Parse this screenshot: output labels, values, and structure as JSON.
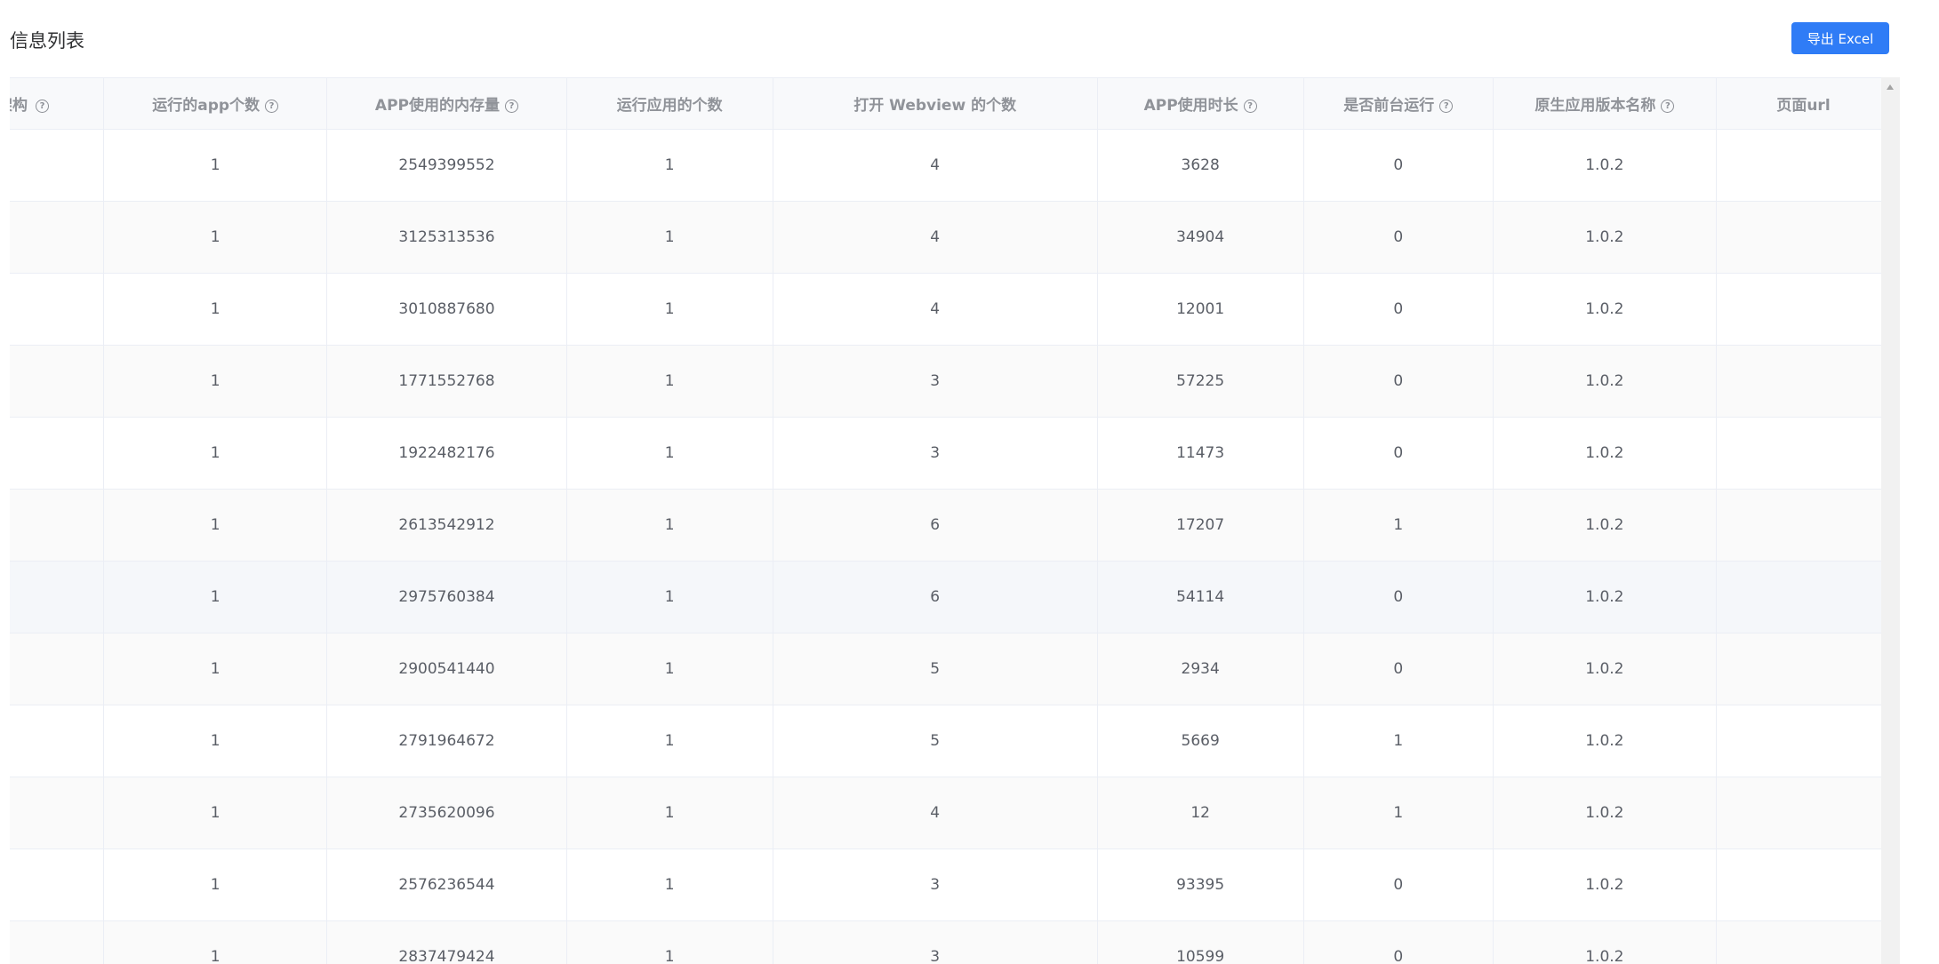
{
  "page": {
    "title": "信息列表"
  },
  "toolbar": {
    "export_label": "导出 Excel"
  },
  "table": {
    "columns": [
      {
        "label": "架构",
        "help": true
      },
      {
        "label": "运行的app个数",
        "help": true
      },
      {
        "label": "APP使用的内存量",
        "help": true
      },
      {
        "label": "运行应用的个数",
        "help": false
      },
      {
        "label": "打开 Webview 的个数",
        "help": false
      },
      {
        "label": "APP使用时长",
        "help": true
      },
      {
        "label": "是否前台运行",
        "help": true
      },
      {
        "label": "原生应用版本名称",
        "help": true
      },
      {
        "label": "页面url",
        "help": false
      }
    ],
    "rows": [
      [
        "",
        "1",
        "2549399552",
        "1",
        "4",
        "3628",
        "0",
        "1.0.2",
        ""
      ],
      [
        "",
        "1",
        "3125313536",
        "1",
        "4",
        "34904",
        "0",
        "1.0.2",
        ""
      ],
      [
        "",
        "1",
        "3010887680",
        "1",
        "4",
        "12001",
        "0",
        "1.0.2",
        ""
      ],
      [
        "",
        "1",
        "1771552768",
        "1",
        "3",
        "57225",
        "0",
        "1.0.2",
        ""
      ],
      [
        "",
        "1",
        "1922482176",
        "1",
        "3",
        "11473",
        "0",
        "1.0.2",
        ""
      ],
      [
        "",
        "1",
        "2613542912",
        "1",
        "6",
        "17207",
        "1",
        "1.0.2",
        ""
      ],
      [
        "",
        "1",
        "2975760384",
        "1",
        "6",
        "54114",
        "0",
        "1.0.2",
        ""
      ],
      [
        "",
        "1",
        "2900541440",
        "1",
        "5",
        "2934",
        "0",
        "1.0.2",
        ""
      ],
      [
        "",
        "1",
        "2791964672",
        "1",
        "5",
        "5669",
        "1",
        "1.0.2",
        ""
      ],
      [
        "",
        "1",
        "2735620096",
        "1",
        "4",
        "12",
        "1",
        "1.0.2",
        ""
      ],
      [
        "",
        "1",
        "2576236544",
        "1",
        "3",
        "93395",
        "0",
        "1.0.2",
        ""
      ],
      [
        "",
        "1",
        "2837479424",
        "1",
        "3",
        "10599",
        "0",
        "1.0.2",
        ""
      ]
    ]
  }
}
